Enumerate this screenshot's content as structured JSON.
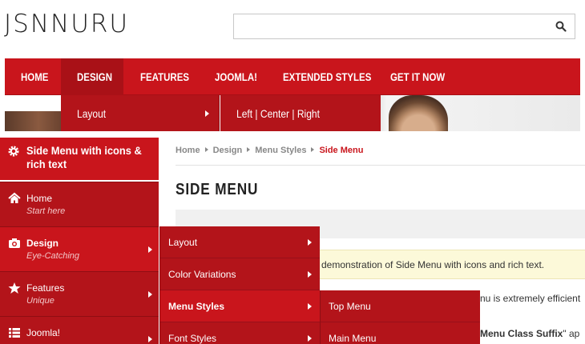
{
  "header": {
    "logo": "JSNNURU",
    "search": {
      "placeholder": "",
      "value": ""
    }
  },
  "nav": {
    "items": [
      "HOME",
      "DESIGN",
      "FEATURES",
      "JOOMLA!",
      "EXTENDED STYLES",
      "GET IT NOW"
    ],
    "active": "DESIGN"
  },
  "design_dropdown": {
    "item": "Layout",
    "submenu": "Left | Center | Right"
  },
  "sidebar": {
    "title": "Side Menu with icons & rich text",
    "items": [
      {
        "label": "Home",
        "sub": "Start here",
        "icon": "home-icon"
      },
      {
        "label": "Design",
        "sub": "Eye-Catching",
        "icon": "camera-icon"
      },
      {
        "label": "Features",
        "sub": "Unique",
        "icon": "star-icon"
      },
      {
        "label": "Joomla!",
        "sub": "",
        "icon": "list-icon"
      }
    ]
  },
  "flyout1": {
    "items": [
      "Layout",
      "Color Variations",
      "Menu Styles",
      "Font Styles"
    ],
    "active": "Menu Styles"
  },
  "flyout2": {
    "items": [
      "Top Menu",
      "Main Menu"
    ]
  },
  "content": {
    "breadcrumb": [
      "Home",
      "Design",
      "Menu Styles",
      "Side Menu"
    ],
    "title": "SIDE MENU",
    "note": "demonstration of Side Menu with icons and rich text.",
    "body1": "nu is extremely efficient",
    "body2_bold": "Menu Class Suffix",
    "body2_rest": "\" ap"
  },
  "colors": {
    "primary": "#c9151c",
    "dark": "#b3141a",
    "note_bg": "#fcf9d9"
  }
}
